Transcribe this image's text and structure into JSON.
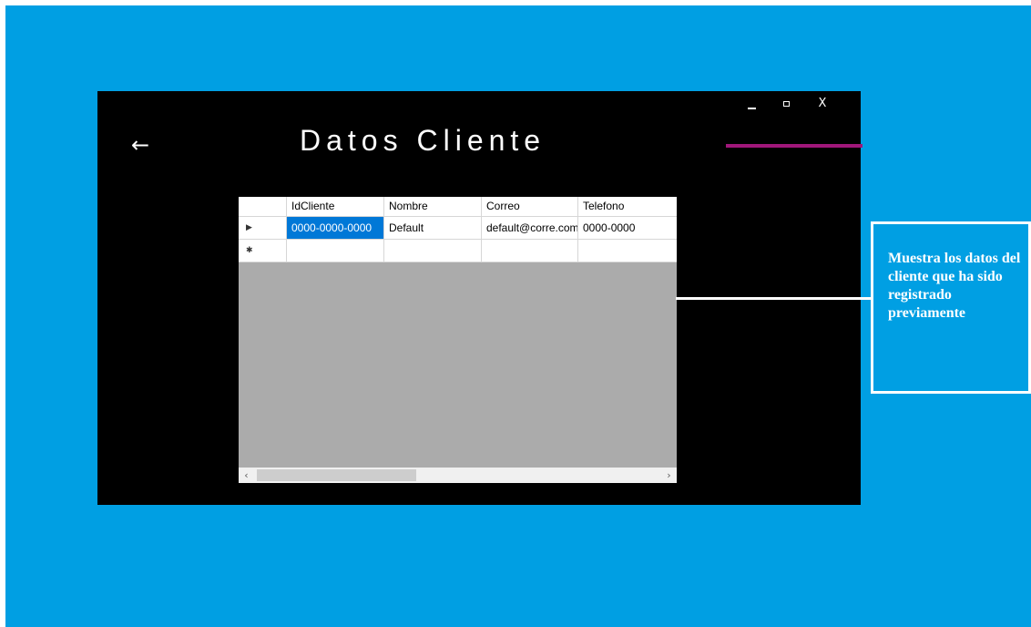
{
  "window": {
    "title": "Datos Cliente",
    "back_glyph": "←",
    "controls": {
      "minimize_icon": "minimize-icon",
      "maximize_icon": "maximize-icon",
      "close_label": "X"
    },
    "accent_color": "#a0177a",
    "background": "#000000"
  },
  "grid": {
    "columns": [
      "IdCliente",
      "Nombre",
      "Correo",
      "Telefono"
    ],
    "rows": [
      {
        "marker": "▶",
        "selected": true,
        "cells": [
          "0000-0000-0000",
          "Default",
          "default@corre.com",
          "0000-0000"
        ]
      },
      {
        "marker": "✱",
        "selected": false,
        "cells": [
          "",
          "",
          "",
          ""
        ]
      }
    ],
    "selection_color": "#0078d7",
    "scroll": {
      "left_glyph": "‹",
      "right_glyph": "›"
    }
  },
  "annotation": {
    "text": "Muestra los datos del cliente que ha sido registrado previamente"
  },
  "colors": {
    "slide_background": "#009fe3",
    "grid_empty_area": "#ababab"
  }
}
